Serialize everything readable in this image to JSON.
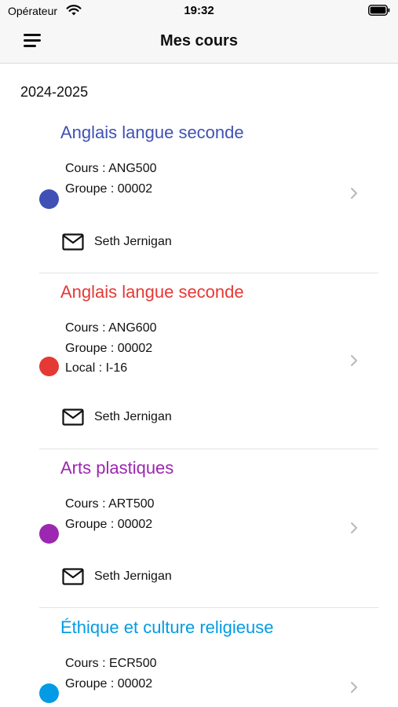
{
  "status_bar": {
    "carrier": "Opérateur",
    "time": "19:32"
  },
  "nav": {
    "title": "Mes cours",
    "menu_icon": "hamburger-menu-icon"
  },
  "school_year": "2024-2025",
  "colors": {
    "blue": "#3f51b5",
    "red": "#e53935",
    "purple": "#9c27b0",
    "cyan": "#039be5"
  },
  "courses": [
    {
      "name": "Anglais langue seconde",
      "color": "#3f51b5",
      "code": "Cours : ANG500",
      "group": "Groupe : 00002",
      "local": "",
      "teacher": "Seth Jernigan"
    },
    {
      "name": "Anglais langue seconde",
      "color": "#e53935",
      "code": "Cours : ANG600",
      "group": "Groupe : 00002",
      "local": "Local : I-16",
      "teacher": "Seth Jernigan"
    },
    {
      "name": "Arts plastiques",
      "color": "#9c27b0",
      "code": "Cours : ART500",
      "group": "Groupe : 00002",
      "local": "",
      "teacher": "Seth Jernigan"
    },
    {
      "name": "Éthique et culture religieuse",
      "color": "#039be5",
      "code": "Cours : ECR500",
      "group": "Groupe : 00002",
      "local": "",
      "teacher": ""
    }
  ]
}
